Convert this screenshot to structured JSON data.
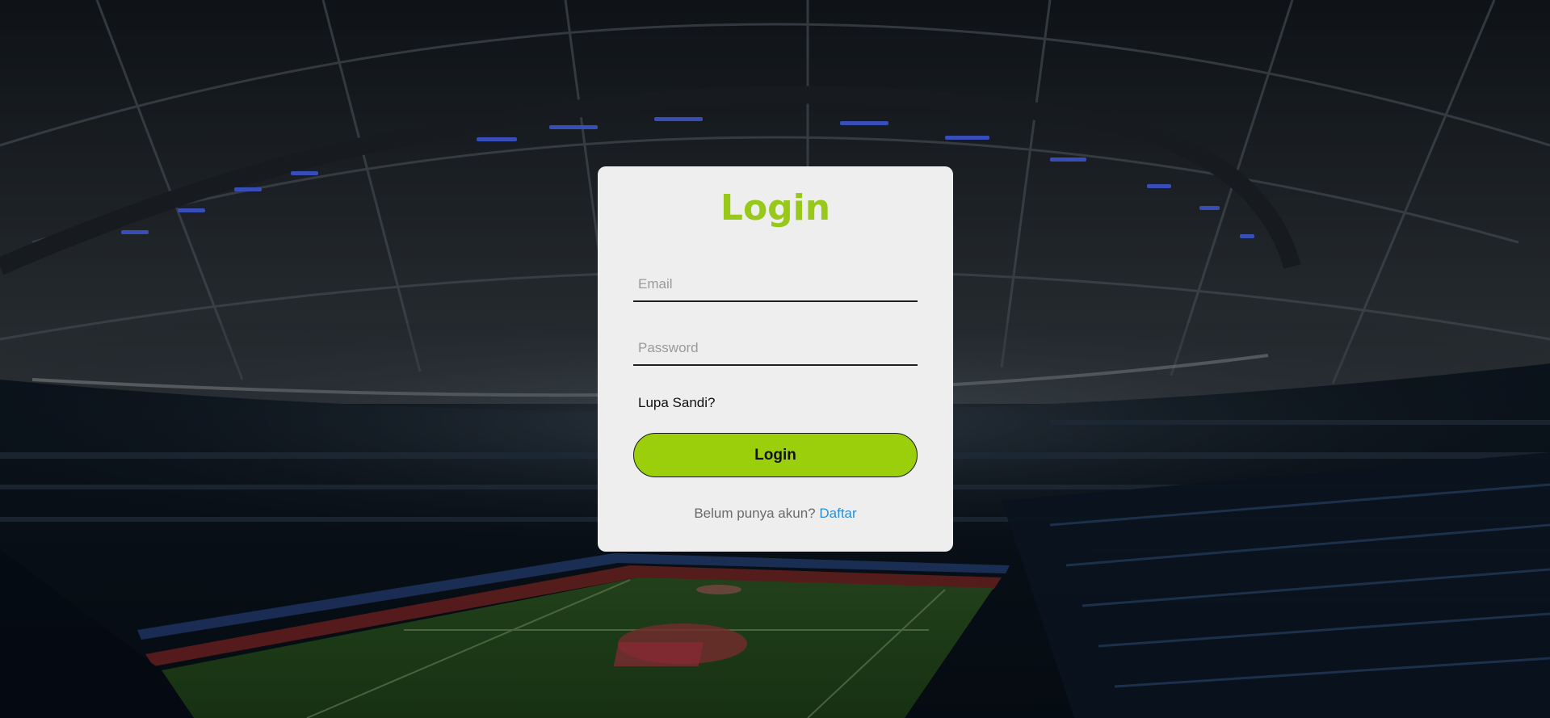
{
  "page": {
    "background": "stadium-photo"
  },
  "login": {
    "title": "Login",
    "email_placeholder": "Email",
    "password_placeholder": "Password",
    "forgot_label": "Lupa Sandi?",
    "button_label": "Login",
    "signup_prompt": "Belum punya akun?",
    "signup_link": "Daftar"
  },
  "colors": {
    "accent": "#98c91a",
    "button": "#9ccf0b",
    "link": "#2b8fd6",
    "card": "#eeeeee"
  }
}
